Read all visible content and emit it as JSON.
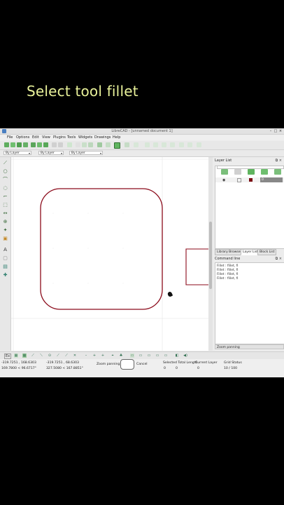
{
  "video_caption": "Select tool fillet",
  "window": {
    "title": "LibreCAD - [unnamed document 1]"
  },
  "menu": [
    "File",
    "Options",
    "Edit",
    "View",
    "Plugins",
    "Tools",
    "Widgets",
    "Drawings",
    "Help"
  ],
  "pen_toolbar": {
    "layer": "By Layer",
    "color": "By Layer",
    "width": "By Layer"
  },
  "layer_list": {
    "title": "Layer List"
  },
  "panel_tabs": [
    "Library Browser",
    "Layer List",
    "Block List"
  ],
  "command_line": {
    "title": "Command line",
    "history": [
      "Fillet : fillet, fi",
      "Fillet : fillet, fi",
      "Fillet : fillet, fi",
      "Fillet : fillet, fi"
    ]
  },
  "zoom_hint": "Zoom panning",
  "status": {
    "coord_abs_1": "-319.7251 , 168.6303",
    "coord_abs_2": "169.7800 < 96.6717°",
    "coord_rel_1": "-319.7251 , 68.6303",
    "coord_rel_2": "327.5080 < 167.8851°",
    "mouse_left": "Zoom panning",
    "mouse_right": "Cancel",
    "selected_label": "Selected Total Length",
    "selected_count": "0",
    "selected_length": "0",
    "current_layer_label": "Current Layer",
    "current_layer": "0",
    "grid_label": "Grid Status",
    "grid_value": "10 / 100"
  },
  "colors": {
    "shape_stroke": "#8b0a1a",
    "caption": "#e9f29a",
    "grid": "#d6d6d6"
  }
}
